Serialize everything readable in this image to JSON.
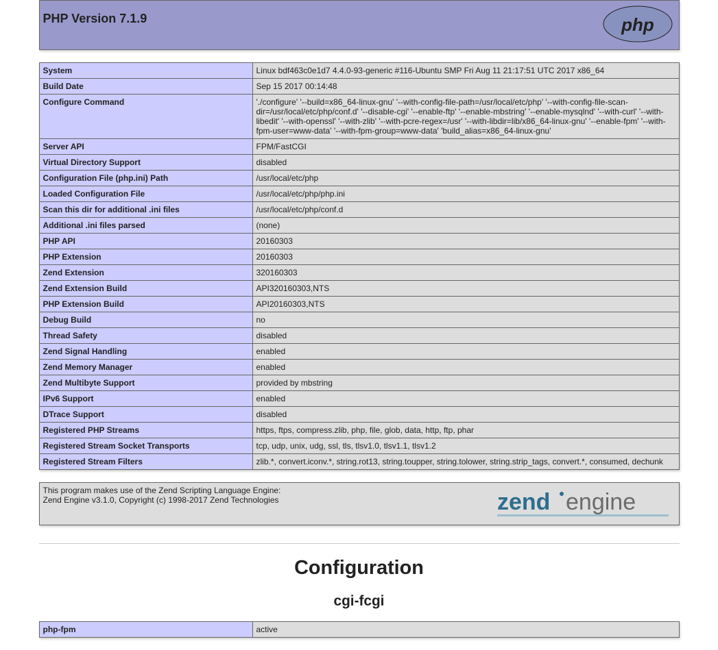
{
  "header": {
    "title": "PHP Version 7.1.9"
  },
  "info": [
    {
      "key": "System",
      "value": "Linux bdf463c0e1d7 4.4.0-93-generic #116-Ubuntu SMP Fri Aug 11 21:17:51 UTC 2017 x86_64"
    },
    {
      "key": "Build Date",
      "value": "Sep 15 2017 00:14:48"
    },
    {
      "key": "Configure Command",
      "value": "'./configure' '--build=x86_64-linux-gnu' '--with-config-file-path=/usr/local/etc/php' '--with-config-file-scan-dir=/usr/local/etc/php/conf.d' '--disable-cgi' '--enable-ftp' '--enable-mbstring' '--enable-mysqlnd' '--with-curl' '--with-libedit' '--with-openssl' '--with-zlib' '--with-pcre-regex=/usr' '--with-libdir=lib/x86_64-linux-gnu' '--enable-fpm' '--with-fpm-user=www-data' '--with-fpm-group=www-data' 'build_alias=x86_64-linux-gnu'"
    },
    {
      "key": "Server API",
      "value": "FPM/FastCGI"
    },
    {
      "key": "Virtual Directory Support",
      "value": "disabled"
    },
    {
      "key": "Configuration File (php.ini) Path",
      "value": "/usr/local/etc/php"
    },
    {
      "key": "Loaded Configuration File",
      "value": "/usr/local/etc/php/php.ini"
    },
    {
      "key": "Scan this dir for additional .ini files",
      "value": "/usr/local/etc/php/conf.d"
    },
    {
      "key": "Additional .ini files parsed",
      "value": "(none)"
    },
    {
      "key": "PHP API",
      "value": "20160303"
    },
    {
      "key": "PHP Extension",
      "value": "20160303"
    },
    {
      "key": "Zend Extension",
      "value": "320160303"
    },
    {
      "key": "Zend Extension Build",
      "value": "API320160303,NTS"
    },
    {
      "key": "PHP Extension Build",
      "value": "API20160303,NTS"
    },
    {
      "key": "Debug Build",
      "value": "no"
    },
    {
      "key": "Thread Safety",
      "value": "disabled"
    },
    {
      "key": "Zend Signal Handling",
      "value": "enabled"
    },
    {
      "key": "Zend Memory Manager",
      "value": "enabled"
    },
    {
      "key": "Zend Multibyte Support",
      "value": "provided by mbstring"
    },
    {
      "key": "IPv6 Support",
      "value": "enabled"
    },
    {
      "key": "DTrace Support",
      "value": "disabled"
    },
    {
      "key": "Registered PHP Streams",
      "value": "https, ftps, compress.zlib, php, file, glob, data, http, ftp, phar"
    },
    {
      "key": "Registered Stream Socket Transports",
      "value": "tcp, udp, unix, udg, ssl, tls, tlsv1.0, tlsv1.1, tlsv1.2"
    },
    {
      "key": "Registered Stream Filters",
      "value": "zlib.*, convert.iconv.*, string.rot13, string.toupper, string.tolower, string.strip_tags, convert.*, consumed, dechunk"
    }
  ],
  "zend": {
    "line1": "This program makes use of the Zend Scripting Language Engine:",
    "line2": "Zend Engine v3.1.0, Copyright (c) 1998-2017 Zend Technologies"
  },
  "configuration": {
    "heading": "Configuration",
    "module1": {
      "name": "cgi-fcgi",
      "rows": [
        {
          "key": "php-fpm",
          "value": "active"
        }
      ]
    }
  }
}
